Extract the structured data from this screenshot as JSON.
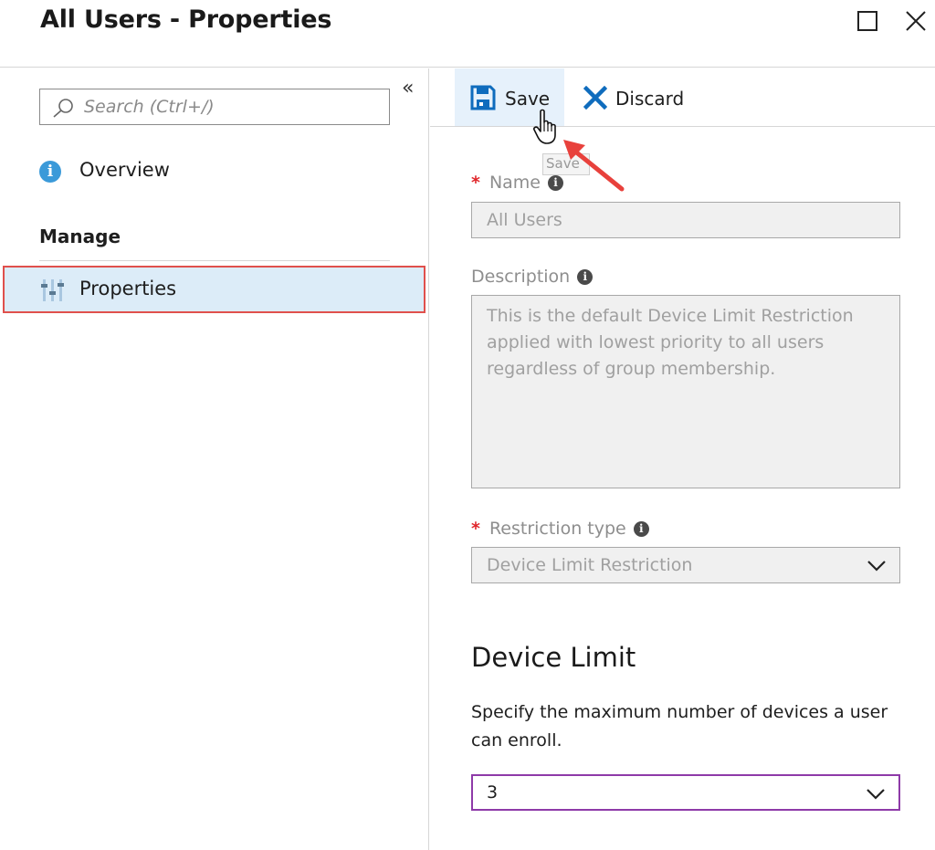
{
  "window": {
    "title": "All Users - Properties",
    "maximize_icon": "square-icon",
    "close_icon": "close-icon"
  },
  "sidebar": {
    "collapse_glyph": "«",
    "search": {
      "placeholder": "Search (Ctrl+/)",
      "value": ""
    },
    "items": [
      {
        "label": "Overview",
        "icon": "info-icon"
      }
    ],
    "section_header": "Manage",
    "selected_item": {
      "label": "Properties",
      "icon": "properties-sliders-icon",
      "highlight_color": "#e0504c"
    }
  },
  "toolbar": {
    "save_label": "Save",
    "discard_label": "Discard",
    "tooltip": "Save"
  },
  "form": {
    "name": {
      "label": "Name",
      "required": "*",
      "value": "All Users"
    },
    "description": {
      "label": "Description",
      "value": "This is the default Device Limit Restriction applied with lowest priority to all users regardless of group membership."
    },
    "restriction_type": {
      "label": "Restriction type",
      "required": "*",
      "value": "Device Limit Restriction"
    },
    "device_limit": {
      "title": "Device Limit",
      "description": "Specify the maximum number of devices a user can enroll.",
      "value": "3"
    }
  },
  "colors": {
    "accent": "#0f6cbd",
    "required": "#e0262b",
    "annotation_arrow": "#e8413c",
    "focus_border": "#8e3aa8",
    "selected_bg": "#dcecf8"
  }
}
